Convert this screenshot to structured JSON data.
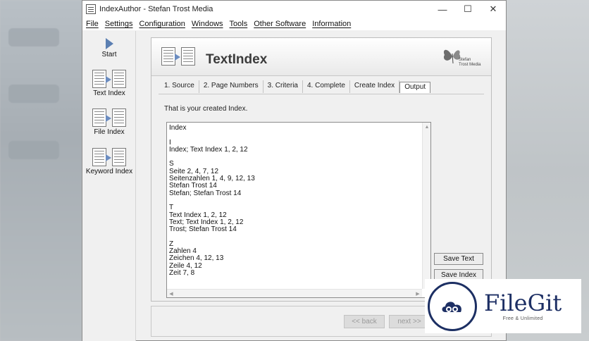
{
  "window": {
    "title": "IndexAuthor - Stefan Trost Media",
    "controls": {
      "minimize": "—",
      "maximize": "☐",
      "close": "✕"
    }
  },
  "menu": [
    "File",
    "Settings",
    "Configuration",
    "Windows",
    "Tools",
    "Other Software",
    "Information"
  ],
  "sidebar": {
    "items": [
      {
        "label": "Start",
        "icon": "play-arrow-icon"
      },
      {
        "label": "Text Index",
        "icon": "text-index-icon"
      },
      {
        "label": "File Index",
        "icon": "file-index-icon"
      },
      {
        "label": "Keyword Index",
        "icon": "keyword-index-icon"
      }
    ]
  },
  "panel": {
    "title": "TextIndex",
    "brand": "Stefan Trost Media",
    "tabs": [
      "1. Source",
      "2. Page Numbers",
      "3. Criteria",
      "4. Complete",
      "Create Index",
      "Output"
    ],
    "active_tab": "Output",
    "intro": "That is your created Index.",
    "output_lines": [
      "Index",
      "",
      "I",
      "Index; Text Index 1, 2, 12",
      "",
      "S",
      "Seite 2, 4, 7, 12",
      "Seitenzahlen 1, 4, 9, 12, 13",
      "Stefan Trost 14",
      "Stefan; Stefan Trost 14",
      "",
      "T",
      "Text Index 1, 2, 12",
      "Text; Text Index 1, 2, 12",
      "Trost; Stefan Trost 14",
      "",
      "Z",
      "Zahlen 4",
      "Zeichen 4, 12, 13",
      "Zeile 4, 12",
      "Zeit 7, 8"
    ],
    "save_text_label": "Save Text",
    "save_index_label": "Save Index"
  },
  "footer": {
    "back_label": "<< back",
    "next_label": "next >>"
  },
  "watermark": {
    "title": "FileGit",
    "subtitle": "Free & Unlimited"
  },
  "colors": {
    "accent": "#5b7fb2",
    "watermark_navy": "#1d2f64"
  }
}
